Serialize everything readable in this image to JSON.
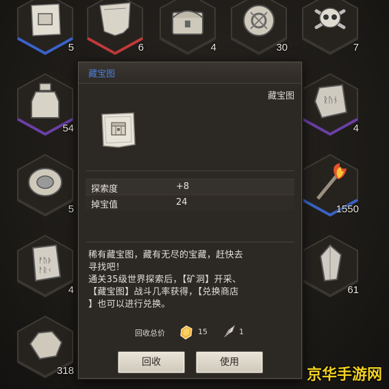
{
  "inventory": {
    "slots": [
      {
        "name": "treasure-map-item",
        "count": "5",
        "border": "#3a63c8"
      },
      {
        "name": "tattered-scroll-item",
        "count": "6",
        "border": "#c03a3a"
      },
      {
        "name": "treasure-chest-item",
        "count": "4",
        "border": "#3a3632"
      },
      {
        "name": "gear-orb-item",
        "count": "30",
        "border": "#3a3632"
      },
      {
        "name": "skull-crossbones-item",
        "count": "7",
        "border": "#3a3632"
      },
      {
        "name": "potion-jar-item",
        "count": "54",
        "border": "#6b3fa6"
      },
      {
        "name": "rune-stone-item",
        "count": "4",
        "border": "#6b3fa6"
      },
      {
        "name": "ornate-amulet-item",
        "count": "5",
        "border": "#3a3632"
      },
      {
        "name": "flaming-torch-item",
        "count": "1550",
        "border": "#3a63c8"
      },
      {
        "name": "rune-tablet-item",
        "count": "4",
        "border": "#3a3632"
      },
      {
        "name": "crystal-shard-item",
        "count": "61",
        "border": "#3a3632"
      },
      {
        "name": "ore-chunk-item",
        "count": "318",
        "border": "#3a3632"
      }
    ]
  },
  "modal": {
    "title": "藏宝图",
    "item_name": "藏宝图",
    "stats": [
      {
        "label": "探索度",
        "value": "+8"
      },
      {
        "label": "掉宝值",
        "value": "24"
      }
    ],
    "description_lines": [
      "稀有藏宝图，藏有无尽的宝藏，赶快去",
      "寻找吧！",
      "通关35级世界探索后，【矿洞】开采、",
      "【藏宝图】战斗几率获得，【兑换商店",
      "】也可以进行兑换。"
    ],
    "recycle": {
      "label": "回收总价",
      "currency1_icon": "gold-crystal-icon",
      "currency1_value": "15",
      "currency2_icon": "feather-icon",
      "currency2_value": "1"
    },
    "buttons": {
      "recycle": "回收",
      "use": "使用"
    }
  },
  "watermark": "京华手游网",
  "colors": {
    "title_blue": "#4a7fd6",
    "rare_blue": "#3a63c8",
    "epic_purple": "#6b3fa6",
    "red": "#c03a3a",
    "watermark_yellow": "#f2d221"
  }
}
